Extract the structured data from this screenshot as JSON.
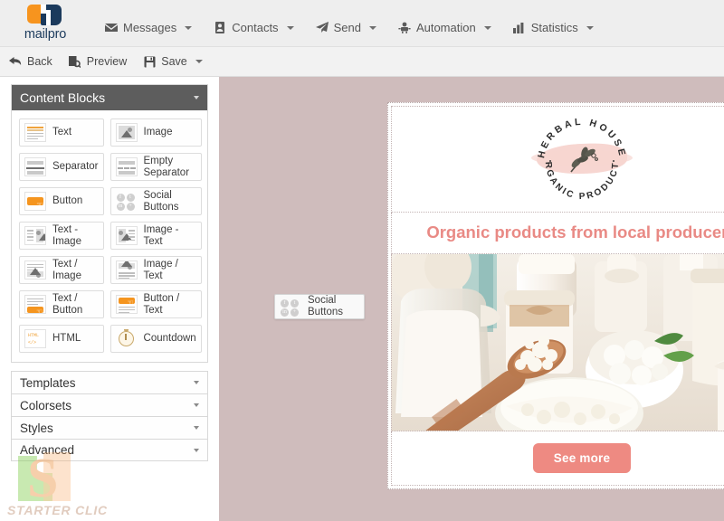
{
  "brand": {
    "name": "mailpro"
  },
  "topnav": {
    "items": [
      {
        "label": "Messages",
        "icon": "envelope-icon",
        "has_caret": true
      },
      {
        "label": "Contacts",
        "icon": "contact-card-icon",
        "has_caret": true
      },
      {
        "label": "Send",
        "icon": "paper-plane-icon",
        "has_caret": true
      },
      {
        "label": "Automation",
        "icon": "robot-icon",
        "has_caret": true
      },
      {
        "label": "Statistics",
        "icon": "bar-chart-icon",
        "has_caret": true
      }
    ]
  },
  "toolbar": {
    "items": [
      {
        "label": "Back",
        "icon": "back-arrow-icon",
        "has_caret": false
      },
      {
        "label": "Preview",
        "icon": "preview-page-icon",
        "has_caret": false
      },
      {
        "label": "Save",
        "icon": "floppy-disk-icon",
        "has_caret": true
      }
    ]
  },
  "sidebar": {
    "panel_title": "Content Blocks",
    "blocks": [
      {
        "label": "Text",
        "icon": "text-lines-icon"
      },
      {
        "label": "Image",
        "icon": "picture-icon"
      },
      {
        "label": "Separator",
        "icon": "separator-icon"
      },
      {
        "label": "Empty Separator",
        "icon": "empty-separator-icon"
      },
      {
        "label": "Button",
        "icon": "button-icon"
      },
      {
        "label": "Social Buttons",
        "icon": "social-buttons-icon"
      },
      {
        "label": "Text - Image",
        "icon": "text-image-icon"
      },
      {
        "label": "Image - Text",
        "icon": "image-text-icon"
      },
      {
        "label": "Text / Image",
        "icon": "text-over-image-icon"
      },
      {
        "label": "Image / Text",
        "icon": "image-over-text-icon"
      },
      {
        "label": "Text / Button",
        "icon": "text-over-button-icon"
      },
      {
        "label": "Button / Text",
        "icon": "button-over-text-icon"
      },
      {
        "label": "HTML",
        "icon": "html-code-icon"
      },
      {
        "label": "Countdown",
        "icon": "stopwatch-icon"
      }
    ],
    "accordions": [
      {
        "label": "Templates"
      },
      {
        "label": "Colorsets"
      },
      {
        "label": "Styles"
      },
      {
        "label": "Advanced"
      }
    ]
  },
  "drag_ghost": {
    "label": "Social Buttons",
    "icon": "social-buttons-icon"
  },
  "email": {
    "logo": {
      "top_text": "HERBAL HOUSE",
      "bottom_text": "ORGANIC PRODUCTS",
      "icon": "leaf-branch-icon"
    },
    "headline": "Organic products from local producers",
    "photo_alt": "dairy-products-photo",
    "cta_label": "See more"
  },
  "watermark": {
    "mark": "S",
    "text": "STARTER CLIC"
  },
  "colors": {
    "canvas_background": "#cfbcbc",
    "accent_salmon": "#e98a85",
    "cta_button": "#ee8a82",
    "brand_orange": "#f7941e",
    "brand_navy": "#1b3a5c",
    "panel_header": "#5d5d5d"
  }
}
